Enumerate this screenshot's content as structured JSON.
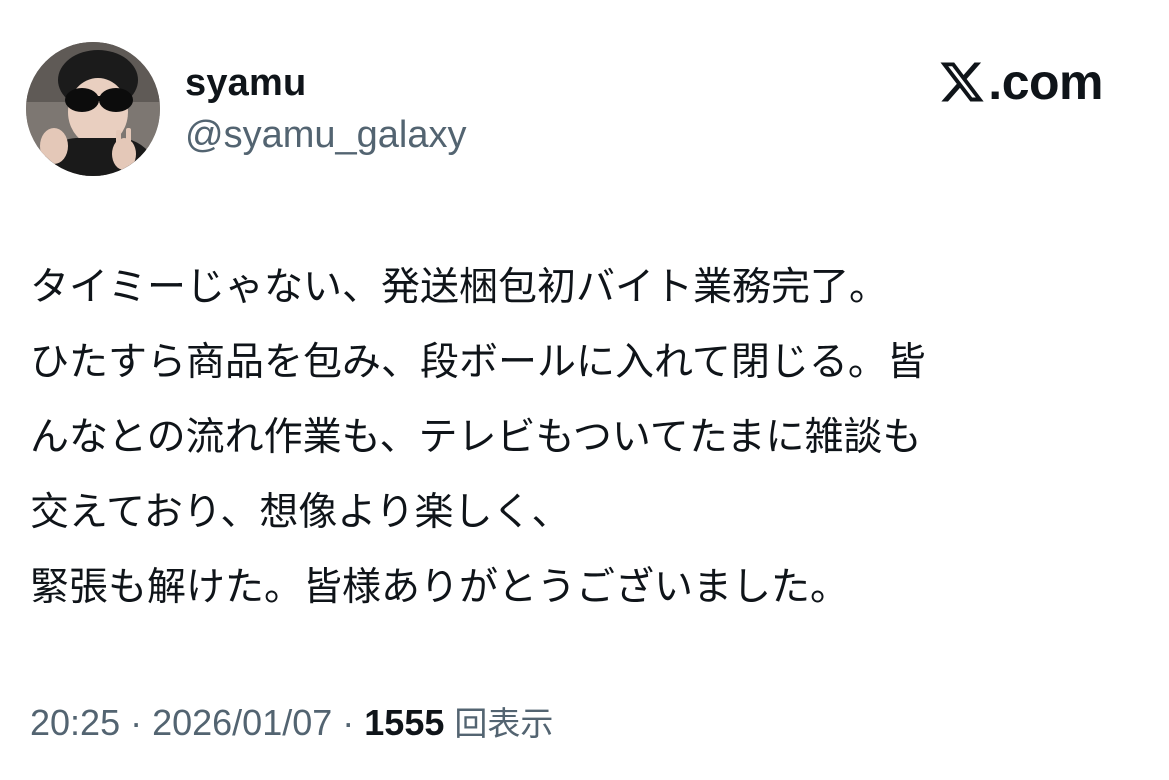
{
  "author": {
    "display_name": "syamu",
    "handle": "@syamu_galaxy",
    "avatar_icon": "profile-photo"
  },
  "brand": {
    "logo_icon": "x-logo-icon",
    "text": ".com"
  },
  "tweet": {
    "lines": [
      "タイミーじゃない、発送梱包初バイト業務完了。",
      "ひたすら商品を包み、段ボールに入れて閉じる。皆",
      "んなとの流れ作業も、テレビもついてたまに雑談も",
      "交えており、想像より楽しく、",
      "緊張も解けた。皆様ありがとうございました。"
    ]
  },
  "meta": {
    "time": "20:25",
    "separator": " · ",
    "date": "2026/01/07",
    "views_count": "1555",
    "views_label": "回表示"
  },
  "colors": {
    "text_primary": "#0f1419",
    "text_secondary": "#536471",
    "background": "#ffffff"
  }
}
